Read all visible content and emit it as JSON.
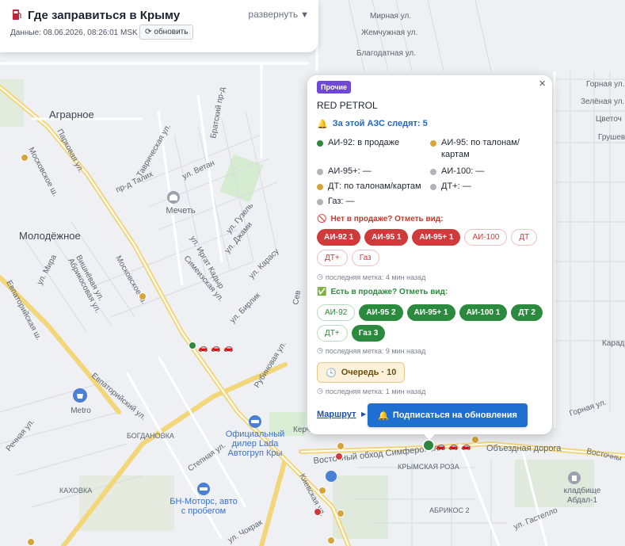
{
  "app": {
    "title": "Где заправиться в Крыму",
    "expand_label": "развернуть",
    "data_line": "Данные: 08.06.2026, 08:26:01 MSK",
    "refresh_label": "обновить"
  },
  "map": {
    "labels": {
      "agrarnoe": "Аграрное",
      "molodezhnoe": "Молодёжное",
      "mechet": "Мечеть",
      "metro": "Metro",
      "bogdanovka": "БОГДАНОВКА",
      "kakhovka": "КАХОВКА",
      "krymskaya_roza": "КРЫМСКАЯ РОЗА",
      "abrikos": "АБРИКОС 2",
      "lada1": "Официальный",
      "lada2": "дилер Lada",
      "lada3": "Автогруп Кры",
      "bn1": "БН-Моторс, авто",
      "bn2": "с пробегом",
      "kladb1": "кладбище",
      "kladb2": "Абдал-1",
      "mirnaya": "Мирная ул.",
      "zhemchuzhnaya": "Жемчужная ул.",
      "blagodatnaya": "Благодатная ул.",
      "gornaya": "Горная ул.",
      "zelenaya": "Зелёная ул.",
      "tsvetoch": "Цветоч",
      "grusheva": "Грушева",
      "gornaya2": "Горная ул.",
      "vostochny": "Восточны",
      "karada": "Карада",
      "obezdnaya": "Объездная дорога",
      "vost_obkhod": "Восточный обход Симферополя",
      "moskovskoe": "Московское ш.",
      "moskovskoe2": "Московское ш.",
      "evpatoriyskaya": "Евпаторийская ш.",
      "evpatoriyskiy": "Евпаторийский ул.",
      "mira": "ул. Мира",
      "kievskaya": "Киевская ул.",
      "stepnaya": "Степная ул.",
      "rechnaya": "Речная ул.",
      "rubinovaya": "Рубиновая ул.",
      "chokrak": "ул. Чокрак",
      "gastello": "ул. Гастелло",
      "verkh": "Верх",
      "kerch": "Керч",
      "tavricheskaya": "Таврическая ул.",
      "parkovaya": "Парковая ул.",
      "bratsky": "Братский пр-д",
      "talikh": "пр-д Талих",
      "vetan": "ул. Ветан",
      "guzel": "ул. Гузель",
      "dzhami": "ул. Джами",
      "irgat": "ул. Иргат Кадыр",
      "simeizskaya": "Симеизская ул.",
      "karasu": "ул. Карасу",
      "birlik": "ул. Бирлик",
      "vishnevaya": "Вишнёвая ул.",
      "abrikosovaya": "Абрикосовая ул.",
      "sev": "Сев"
    }
  },
  "popup": {
    "category": "Прочие",
    "station_name": "RED PETROL",
    "watchers": "За этой АЗС следят: 5",
    "fuels": [
      {
        "text": "АИ-92: в продаже",
        "color": "#2b8a3e"
      },
      {
        "text": "АИ-95: по талонам/ картам",
        "color": "#d6a53a"
      },
      {
        "text": "АИ-95+: —",
        "color": "#b0b4ba"
      },
      {
        "text": "АИ-100: —",
        "color": "#b0b4ba"
      },
      {
        "text": "ДТ: по талонам/картам",
        "color": "#d6a53a"
      },
      {
        "text": "ДТ+: —",
        "color": "#b0b4ba"
      },
      {
        "text": "Газ: —",
        "color": "#b0b4ba"
      }
    ],
    "not_available_title": "Нет в продаже? Отметь вид:",
    "not_available_chips": [
      {
        "label": "АИ-92 1",
        "style": "red"
      },
      {
        "label": "АИ-95 1",
        "style": "red"
      },
      {
        "label": "АИ-95+ 1",
        "style": "red"
      },
      {
        "label": "АИ-100",
        "style": "red-out"
      },
      {
        "label": "ДТ",
        "style": "red-out"
      },
      {
        "label": "ДТ+",
        "style": "red-out"
      },
      {
        "label": "Газ",
        "style": "red-out"
      }
    ],
    "not_available_last": "последняя метка: 4 мин назад",
    "available_title": "Есть в продаже? Отметь вид:",
    "available_chips": [
      {
        "label": "АИ-92",
        "style": "green-out"
      },
      {
        "label": "АИ-95 2",
        "style": "green"
      },
      {
        "label": "АИ-95+ 1",
        "style": "green"
      },
      {
        "label": "АИ-100 1",
        "style": "green"
      },
      {
        "label": "ДТ 2",
        "style": "green"
      },
      {
        "label": "ДТ+",
        "style": "green-out"
      },
      {
        "label": "Газ 3",
        "style": "green"
      }
    ],
    "available_last": "последняя метка: 9 мин назад",
    "queue_label": "Очередь · 10",
    "queue_last": "последняя метка: 1 мин назад",
    "route_label": "Маршрут",
    "subscribe_label": "Подписаться на обновления"
  },
  "colors": {
    "accent_blue": "#1f6fd1",
    "red": "#cf3a3a",
    "green": "#2b8a3e",
    "amber": "#d6a53a",
    "purple": "#7048d6"
  }
}
